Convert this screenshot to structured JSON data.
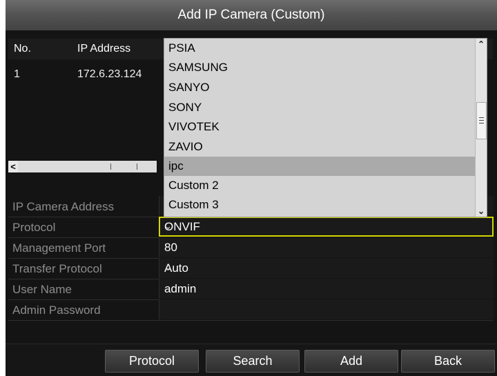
{
  "dialog": {
    "title": "Add IP Camera (Custom)"
  },
  "table": {
    "columns": [
      "No.",
      "IP Address"
    ],
    "rows": [
      {
        "no": "1",
        "ip": "172.6.23.124"
      }
    ]
  },
  "form": {
    "fields": [
      {
        "label": "IP Camera Address",
        "value": ""
      },
      {
        "label": "Protocol",
        "value": "ONVIF"
      },
      {
        "label": "Management Port",
        "value": "80"
      },
      {
        "label": "Transfer Protocol",
        "value": "Auto"
      },
      {
        "label": "User Name",
        "value": "admin"
      },
      {
        "label": "Admin Password",
        "value": ""
      }
    ]
  },
  "protocol_dropdown": {
    "options": [
      "PSIA",
      "SAMSUNG",
      "SANYO",
      "SONY",
      "VIVOTEK",
      "ZAVIO",
      "ipc",
      "Custom 2",
      "Custom 3"
    ],
    "highlighted": "ipc"
  },
  "buttons": {
    "protocol": "Protocol",
    "search": "Search",
    "add": "Add",
    "back": "Back"
  },
  "colors": {
    "selected_outline": "#d6d600",
    "dropdown_bg": "#d4d4d4",
    "highlight": "#aaaaaa"
  }
}
